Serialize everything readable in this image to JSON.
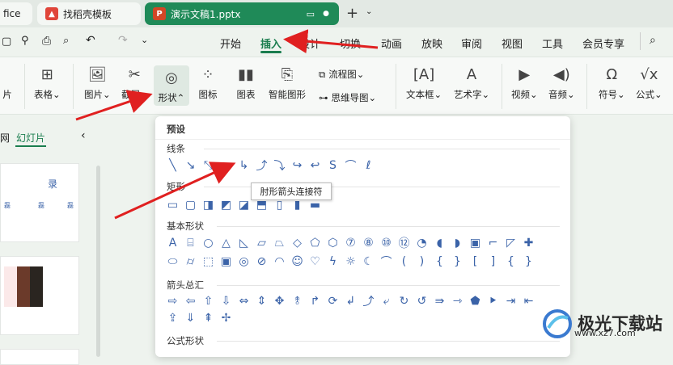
{
  "tabs": [
    {
      "label": "fice",
      "icon": "partial-tab"
    },
    {
      "label": "找稻壳模板",
      "icon": "docer-icon"
    },
    {
      "label": "演示文稿1.pptx",
      "icon": "ppt-icon"
    }
  ],
  "menu": {
    "items": [
      "开始",
      "插入",
      "设计",
      "切换",
      "动画",
      "放映",
      "审阅",
      "视图",
      "工具",
      "会员专享"
    ],
    "active": "插入"
  },
  "ribbon": {
    "table": "表格",
    "picture": "图片",
    "screenshot": "截屏",
    "shape": "形状",
    "icon": "图标",
    "chart": "图表",
    "smart": "智能图形",
    "flowchart": "流程图",
    "mindmap": "思维导图",
    "textbox": "文本框",
    "arttext": "艺术字",
    "video": "视频",
    "audio": "音频",
    "symbol": "符号",
    "formula": "公式",
    "left_partial": "片"
  },
  "panel": {
    "outline": "网",
    "slides": "幻灯片",
    "slide1_char": "录",
    "small_text": "磊"
  },
  "dropdown": {
    "preset": "预设",
    "lines": "线条",
    "rect": "矩形",
    "basic": "基本形状",
    "arrows": "箭头总汇",
    "formula": "公式形状",
    "tooltip": "肘形箭头连接符"
  },
  "watermark": {
    "text": "极光下载站",
    "url": "www.xz7.com"
  },
  "colors": {
    "accent": "#1a7d4e",
    "tab_active": "#1f8a58",
    "ppt": "#d24726",
    "arrow": "#e02020",
    "shape": "#3b63a8"
  }
}
